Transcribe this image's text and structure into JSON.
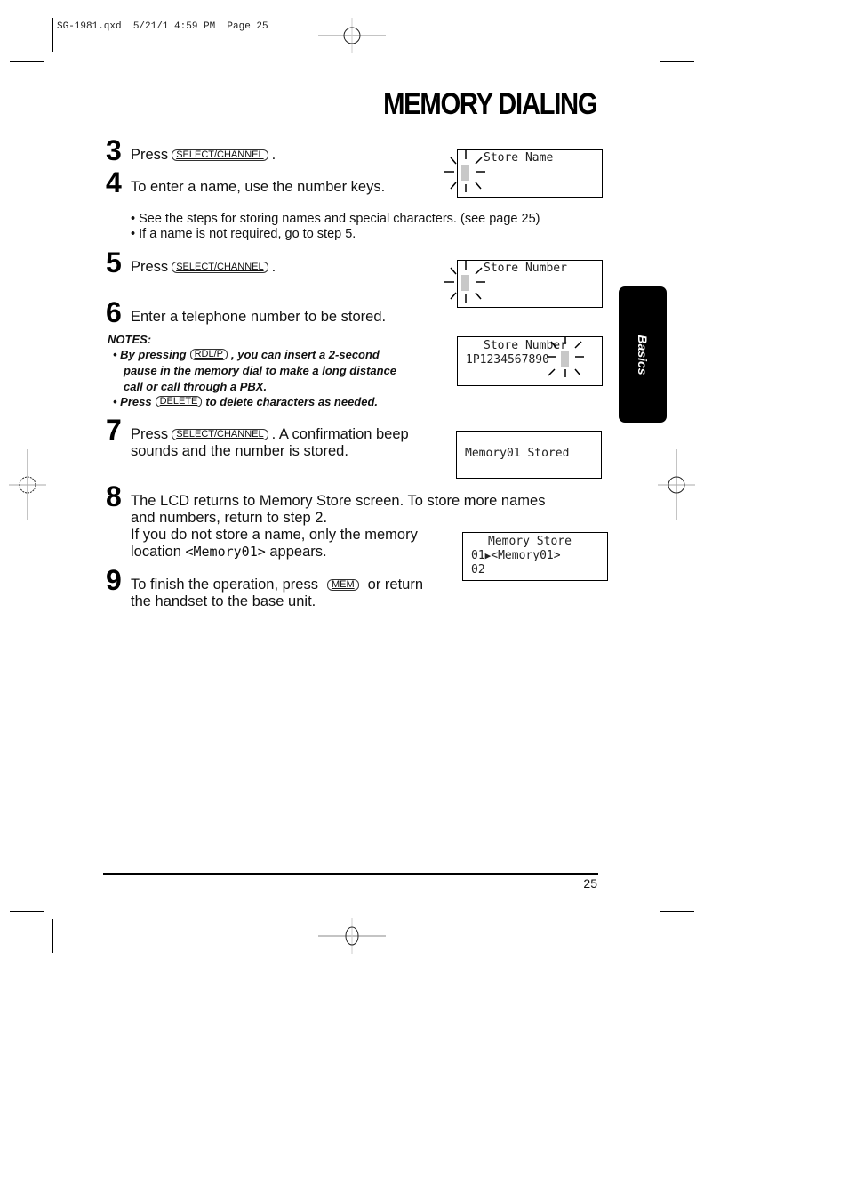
{
  "slug": "SG-1981.qxd  5/21/1 4:59 PM  Page 25",
  "title": "MEMORY DIALING",
  "side_tab": "Basics",
  "page_number": "25",
  "steps": {
    "s3": {
      "num": "3",
      "pre": "Press",
      "key": "SELECT/CHANNEL",
      "post": "."
    },
    "s4": {
      "num": "4",
      "text": "To enter a name, use the number keys."
    },
    "bullets": [
      "• See the steps for storing names and special characters. (see page 25)",
      "• If a name is not required, go to step 5."
    ],
    "s5": {
      "num": "5",
      "pre": "Press",
      "key": "SELECT/CHANNEL",
      "post": "."
    },
    "s6": {
      "num": "6",
      "text": "Enter a telephone number to be stored."
    },
    "notes": {
      "heading": "NOTES:",
      "n1_pre": "• By pressing",
      "n1_key": "RDL/P",
      "n1_post": ", you can insert a 2-second",
      "n1_line2": "pause in the memory dial to make a long distance",
      "n1_line3": "call or call through a PBX.",
      "n2_pre": "• Press",
      "n2_key": "DELETE",
      "n2_post": "to delete characters as needed."
    },
    "s7": {
      "num": "7",
      "pre": "Press",
      "key": "SELECT/CHANNEL",
      "post": ".  A confirmation beep",
      "line2": "sounds and the number is stored."
    },
    "s8": {
      "num": "8",
      "line1": "The LCD returns to Memory Store screen. To store more names",
      "line2": "and numbers, return to step 2.",
      "line3": "If you do not store a name, only the memory",
      "line4_pre": "location",
      "line4_mono": "<Memory01>",
      "line4_post": "appears."
    },
    "s9": {
      "num": "9",
      "pre": "To finish the operation, press",
      "key": "MEM",
      "post": "or return",
      "line2": "the handset to the base unit."
    }
  },
  "lcds": {
    "store_name": {
      "line1": "Store Name"
    },
    "store_number": {
      "line1": "Store Number"
    },
    "store_number_entered": {
      "line1": "Store Number",
      "line2": "1P1234567890"
    },
    "stored": {
      "line1": "Memory01 Stored"
    },
    "memory_store": {
      "line1": "Memory Store",
      "line2_a": "01",
      "line2_b": "<Memory01>",
      "line3": "02"
    }
  }
}
